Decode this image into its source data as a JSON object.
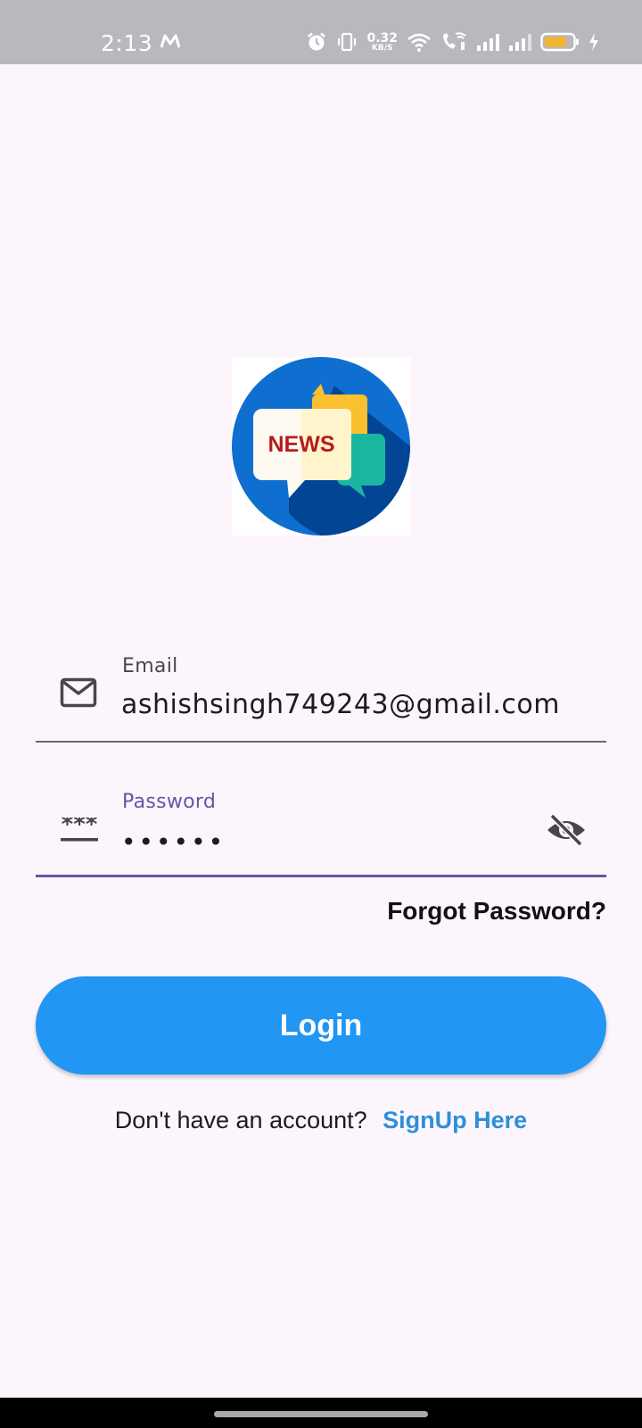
{
  "status_bar": {
    "time": "2:13",
    "net_speed_value": "0.32",
    "net_speed_unit": "KB/S",
    "icons": [
      "m-logo-icon",
      "alarm-icon",
      "vibrate-icon",
      "wifi-icon",
      "wifi-calling-icon",
      "signal-icon",
      "signal-icon",
      "battery-icon",
      "charging-icon"
    ]
  },
  "logo": {
    "text": "NEWS"
  },
  "email": {
    "label": "Email",
    "value": "ashishsingh749243@gmail.com",
    "icon": "mail-icon"
  },
  "password": {
    "label": "Password",
    "value": "••••••",
    "icon": "password-icon",
    "toggle_icon": "visibility-off-icon"
  },
  "forgot_password": "Forgot Password?",
  "login_button": "Login",
  "signup": {
    "text": "Don't have an account?",
    "link": "SignUp Here"
  },
  "colors": {
    "background": "#fcf6fc",
    "status_bar": "#bbb8bd",
    "primary_button": "#2196f3",
    "focus_accent": "#6555a6",
    "link": "#2d8fdb"
  }
}
